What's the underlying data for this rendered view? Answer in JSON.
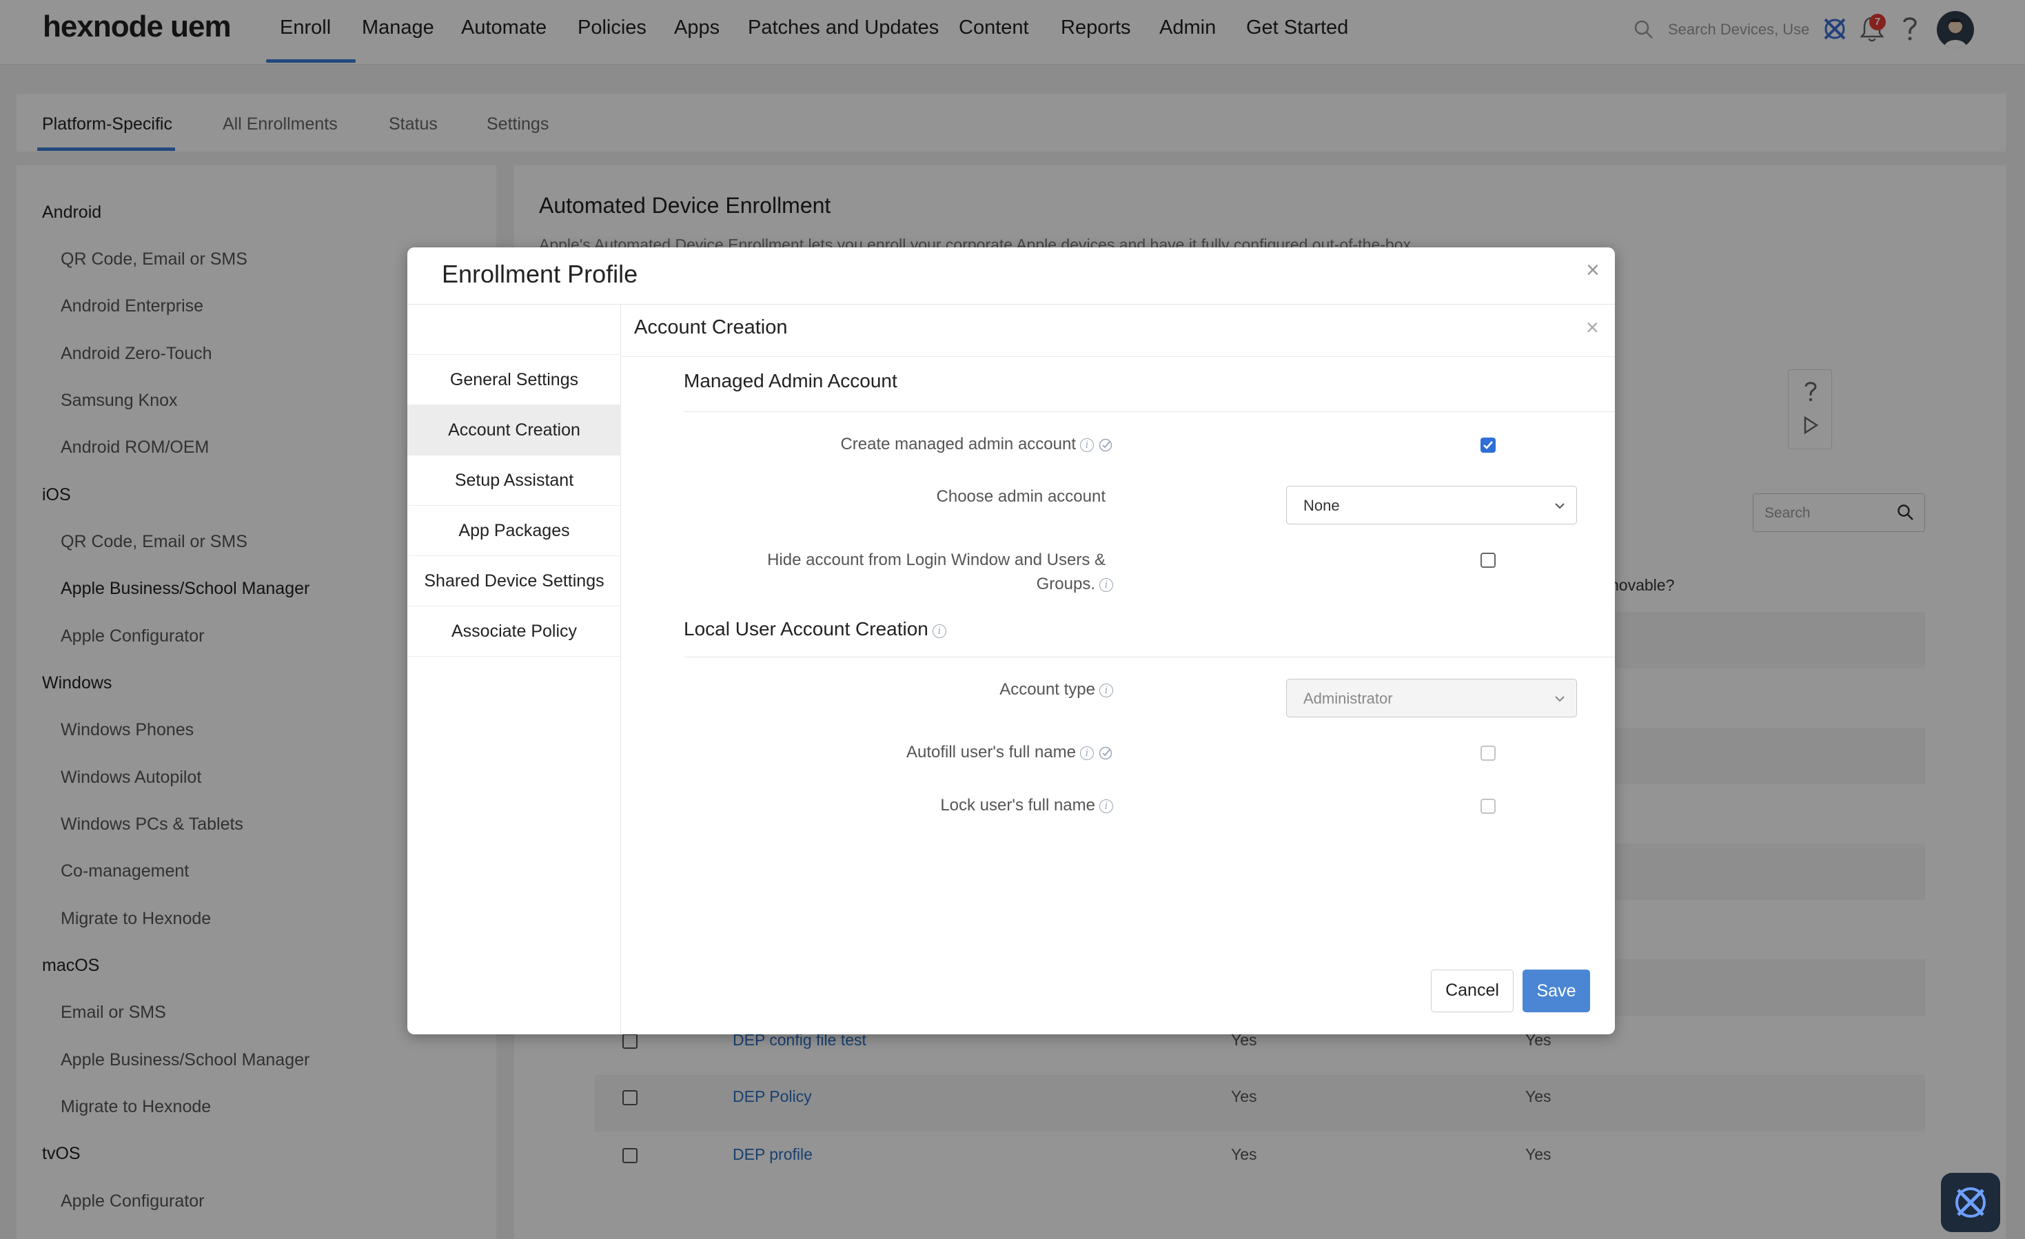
{
  "topnav": {
    "logo": "hexnode uem",
    "items": [
      "Enroll",
      "Manage",
      "Automate",
      "Policies",
      "Apps",
      "Patches and Updates",
      "Content",
      "Reports",
      "Admin",
      "Get Started"
    ],
    "search_placeholder": "Search Devices, Use",
    "notification_count": "7",
    "accent": "#3d7fd4"
  },
  "subtabs": [
    "Platform-Specific",
    "All Enrollments",
    "Status",
    "Settings"
  ],
  "sidebar": {
    "groups": [
      {
        "title": "Android",
        "items": [
          "QR Code, Email or SMS",
          "Android Enterprise",
          "Android Zero-Touch",
          "Samsung Knox",
          "Android ROM/OEM"
        ]
      },
      {
        "title": "iOS",
        "items": [
          "QR Code, Email or SMS",
          "Apple Business/School Manager",
          "Apple Configurator"
        ]
      },
      {
        "title": "Windows",
        "items": [
          "Windows Phones",
          "Windows Autopilot",
          "Windows PCs & Tablets",
          "Co-management",
          "Migrate to Hexnode"
        ]
      },
      {
        "title": "macOS",
        "items": [
          "Email or SMS",
          "Apple Business/School Manager",
          "Migrate to Hexnode"
        ]
      },
      {
        "title": "tvOS",
        "items": [
          "Apple Configurator"
        ]
      }
    ]
  },
  "main": {
    "title": "Automated Device Enrollment",
    "description": "Apple's Automated Device Enrollment lets you enroll your corporate Apple devices and have it fully configured out-of-the-box",
    "search_placeholder": "Search",
    "column_tail": "novable?",
    "rows": [
      {
        "name": "DEP config file test",
        "col1": "Yes",
        "col2": "Yes"
      },
      {
        "name": "DEP Policy",
        "col1": "Yes",
        "col2": "Yes"
      },
      {
        "name": "DEP profile",
        "col1": "Yes",
        "col2": "Yes"
      }
    ]
  },
  "modal": {
    "title": "Enrollment Profile",
    "nav": [
      "General Settings",
      "Account Creation",
      "Setup Assistant",
      "App Packages",
      "Shared Device Settings",
      "Associate Policy"
    ],
    "panel_title": "Account Creation",
    "managed_section": {
      "title": "Managed Admin Account",
      "create_label": "Create managed admin account",
      "create_checked": true,
      "choose_label": "Choose admin account",
      "choose_value": "None",
      "hide_label_line1": "Hide account from Login Window and Users &",
      "hide_label_line2": "Groups.",
      "hide_checked": false
    },
    "local_section": {
      "title": "Local User Account Creation",
      "account_type_label": "Account type",
      "account_type_value": "Administrator",
      "autofill_label": "Autofill user's full name",
      "lock_label": "Lock user's full name"
    },
    "cancel_label": "Cancel",
    "save_label": "Save",
    "save_color": "#4a86d4",
    "checkbox_color": "#2f6fd6"
  }
}
